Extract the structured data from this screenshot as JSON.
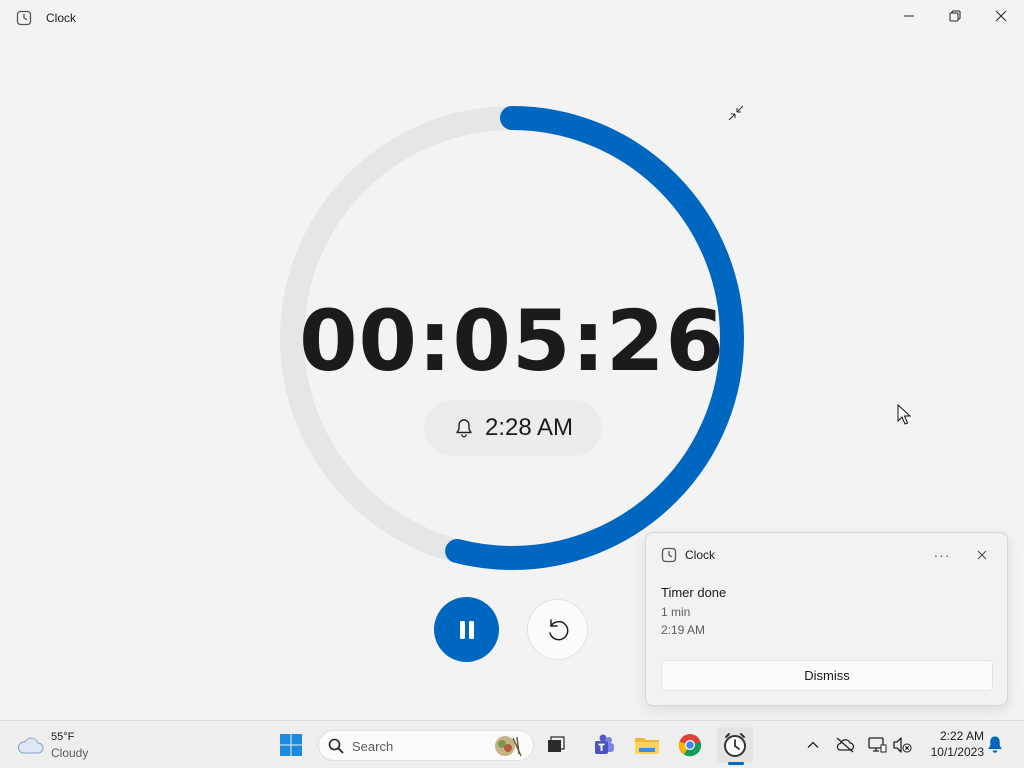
{
  "window": {
    "title": "Clock"
  },
  "icons": {
    "app": "clock-icon",
    "minimize": "minimize-icon",
    "maximize": "restore-icon",
    "close": "close-icon",
    "compact": "compact-overlay-icon",
    "alarm": "bell-icon",
    "pause": "pause-icon",
    "reset": "reset-icon"
  },
  "timer": {
    "remaining": "00:05:26",
    "end_time": "2:28 AM",
    "progress_fraction": 0.54,
    "ring_color": "#0067c0",
    "track_color": "#e6e6e6"
  },
  "notification": {
    "app_name": "Clock",
    "more_label": "···",
    "title": "Timer done",
    "line1": "1 min",
    "line2": "2:19 AM",
    "dismiss_label": "Dismiss"
  },
  "taskbar": {
    "weather": {
      "temperature": "55°F",
      "condition": "Cloudy"
    },
    "search": {
      "placeholder": "Search"
    },
    "pinned": [
      "start-icon",
      "task-view-icon",
      "teams-icon",
      "file-explorer-icon",
      "chrome-icon",
      "clock-app-icon"
    ],
    "tray": [
      "chevron-up-icon",
      "onedrive-offline-icon",
      "network-icon",
      "volume-muted-icon"
    ],
    "clock": {
      "time": "2:22 AM",
      "date": "10/1/2023"
    },
    "accent": "#0067c0"
  }
}
